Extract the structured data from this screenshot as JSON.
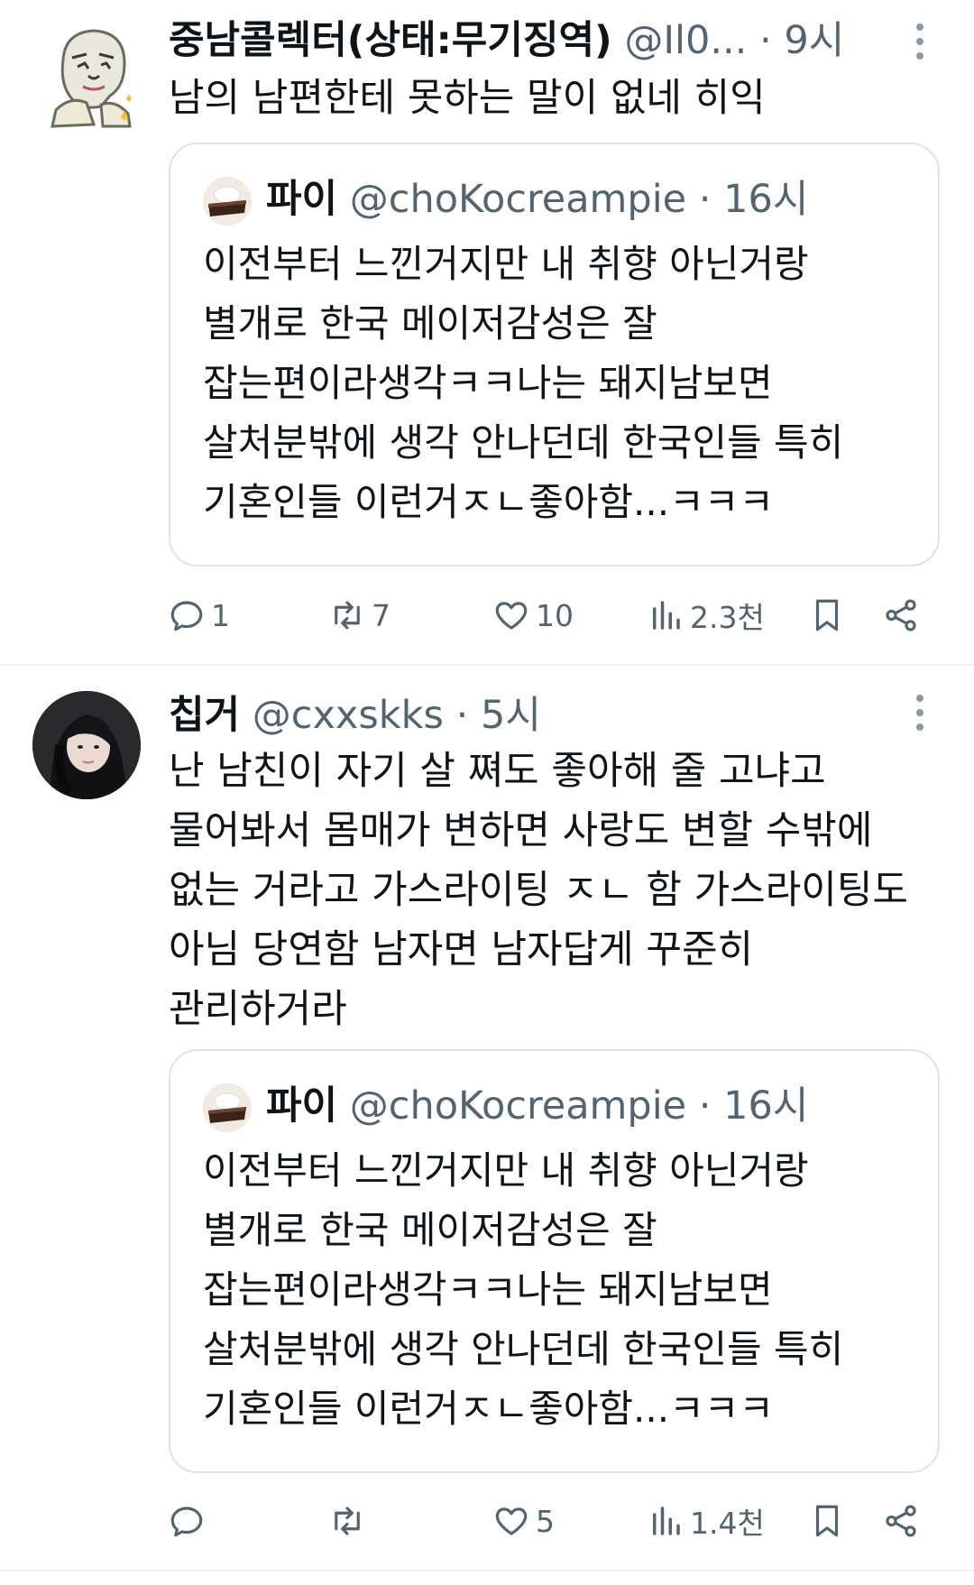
{
  "tweets": [
    {
      "name": "중남콜렉터(상태:무기징역)",
      "handle": "@Il0...",
      "sep": " · ",
      "time": "9시",
      "text": "남의 남편한테 못하는 말이 없네 히익",
      "quote": {
        "name": "파이",
        "handle": "@choKocreampie",
        "sep": " · ",
        "time": "16시",
        "text": "이전부터 느낀거지만 내 취향 아닌거랑\n별개로 한국 메이저감성은 잘\n잡는편이라생각ㅋㅋ나는 돼지남보면\n살처분밖에 생각 안나던데 한국인들 특히\n기혼인들 이런거ㅈㄴ좋아함...ㅋㅋㅋ"
      },
      "actions": {
        "replies": "1",
        "retweets": "7",
        "likes": "10",
        "views": "2.3천"
      }
    },
    {
      "name": "칩거",
      "handle": "@cxxskks",
      "sep": " · ",
      "time": "5시",
      "text": "난 남친이 자기 살 쪄도 좋아해 줄 고냐고\n물어봐서 몸매가 변하면 사랑도 변할 수밖에\n없는 거라고 가스라이팅 ㅈㄴ 함 가스라이팅도\n아님 당연함 남자면 남자답게 꾸준히\n관리하거라",
      "quote": {
        "name": "파이",
        "handle": "@choKocreampie",
        "sep": " · ",
        "time": "16시",
        "text": "이전부터 느낀거지만 내 취향 아닌거랑\n별개로 한국 메이저감성은 잘\n잡는편이라생각ㅋㅋ나는 돼지남보면\n살처분밖에 생각 안나던데 한국인들 특히\n기혼인들 이런거ㅈㄴ좋아함...ㅋㅋㅋ"
      },
      "actions": {
        "replies": "",
        "retweets": "",
        "likes": "5",
        "views": "1.4천"
      }
    }
  ],
  "icons": {
    "reply": "reply-icon",
    "retweet": "retweet-icon",
    "like": "heart-icon",
    "views": "views-icon",
    "bookmark": "bookmark-icon",
    "share": "share-icon",
    "more": "more-icon"
  },
  "colors": {
    "text": "#0f1419",
    "secondary": "#536471",
    "border": "#dfe3e8"
  }
}
